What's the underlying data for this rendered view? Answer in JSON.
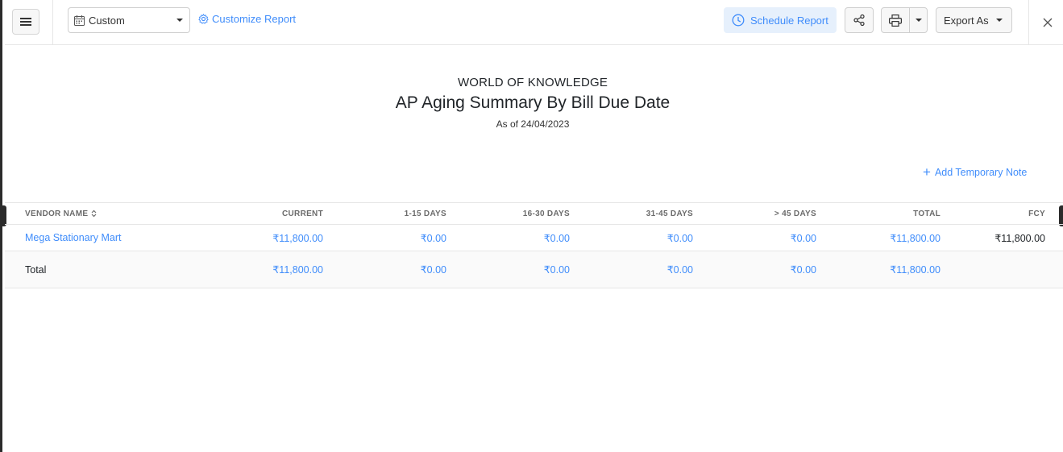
{
  "toolbar": {
    "date_range": "Custom",
    "customize_label": "Customize Report",
    "schedule_label": "Schedule Report",
    "export_label": "Export As"
  },
  "report": {
    "organization": "WORLD OF KNOWLEDGE",
    "title": "AP Aging Summary By Bill Due Date",
    "as_of": "As of 24/04/2023",
    "add_note_label": "Add Temporary Note"
  },
  "table": {
    "columns": [
      "VENDOR NAME",
      "CURRENT",
      "1-15 DAYS",
      "16-30 DAYS",
      "31-45 DAYS",
      "> 45 DAYS",
      "TOTAL",
      "FCY"
    ],
    "rows": [
      [
        "Mega Stationary Mart",
        "₹11,800.00",
        "₹0.00",
        "₹0.00",
        "₹0.00",
        "₹0.00",
        "₹11,800.00",
        "₹11,800.00"
      ]
    ],
    "total_row": [
      "Total",
      "₹11,800.00",
      "₹0.00",
      "₹0.00",
      "₹0.00",
      "₹0.00",
      "₹11,800.00",
      ""
    ]
  },
  "colors": {
    "accent": "#408dfb",
    "schedule_bg": "#e6f0fc",
    "border": "#e6e6e6"
  },
  "icons": [
    "menu-icon",
    "calendar-icon",
    "gear-icon",
    "clock-icon",
    "share-icon",
    "printer-icon",
    "chevron-down-icon",
    "close-icon",
    "plus-icon",
    "sort-icon"
  ]
}
